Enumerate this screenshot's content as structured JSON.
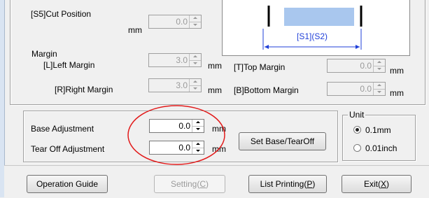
{
  "top_panel": {
    "cut_position": {
      "label": "[S5]Cut Position",
      "unit": "mm",
      "value": "0.0"
    },
    "preview": {
      "dimension_label": "[S1](S2)"
    },
    "margin": {
      "heading": "Margin",
      "left": {
        "label": "[L]Left Margin",
        "value": "3.0",
        "unit": "mm"
      },
      "right": {
        "label": "[R]Right Margin",
        "value": "3.0",
        "unit": "mm"
      },
      "top": {
        "label": "[T]Top Margin",
        "value": "0.0",
        "unit": "mm"
      },
      "bottom": {
        "label": "[B]Bottom Margin",
        "value": "0.0",
        "unit": "mm"
      }
    }
  },
  "adjust_panel": {
    "base": {
      "label": "Base Adjustment",
      "value": "0.0",
      "unit": "mm"
    },
    "tear_off": {
      "label": "Tear Off Adjustment",
      "value": "0.0",
      "unit": "mm"
    },
    "set_button": "Set Base/TearOff"
  },
  "unit_group": {
    "title": "Unit",
    "options": [
      {
        "label": "0.1mm",
        "checked": true
      },
      {
        "label": "0.01inch",
        "checked": false
      }
    ]
  },
  "footer": {
    "operation_guide": "Operation Guide",
    "setting": {
      "text": "Setting(",
      "key": "C",
      "end": ")"
    },
    "list_printing": {
      "text": "List Printing(",
      "key": "P",
      "end": ")"
    },
    "exit": {
      "text": "Exit(",
      "key": "X",
      "end": ")"
    }
  },
  "colors": {
    "highlight_ellipse": "#e21b1b",
    "preview_block": "#a9c7ee",
    "dimension_line": "#1f3fd8"
  }
}
